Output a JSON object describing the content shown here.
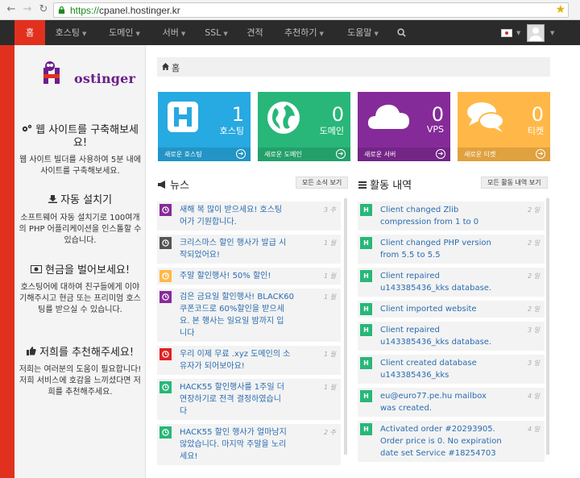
{
  "browser": {
    "url_protocol": "https://",
    "url_rest": "cpanel.hostinger.kr"
  },
  "nav": {
    "items": [
      {
        "label": "홈",
        "dropdown": false
      },
      {
        "label": "호스팅",
        "dropdown": true
      },
      {
        "label": "도메인",
        "dropdown": true
      },
      {
        "label": "서버",
        "dropdown": true
      },
      {
        "label": "SSL",
        "dropdown": true
      },
      {
        "label": "견적",
        "dropdown": false
      },
      {
        "label": "추천하기",
        "dropdown": true
      },
      {
        "label": "도움말",
        "dropdown": true
      }
    ],
    "accent": "#e2301e",
    "background": "#2b2b2b"
  },
  "sidebar": {
    "logo_text": "ostinger",
    "sections": [
      {
        "icon": "gears-icon",
        "title": "웹 사이트를 구축해보세요!",
        "text": "웹 사이트 빌더를 사용하여 5분 내에 사이트를 구축해보세요."
      },
      {
        "icon": "download-icon",
        "title": "자동 설치기",
        "text": "소프트웨어 자동 설치기로 100여개의 PHP 어플리케이션을 인스톨할 수 있습니다."
      },
      {
        "icon": "money-icon",
        "title": "현금을 벌어보세요!",
        "text": "호스팅어에 대하여 친구들에게 이야기해주시고 현금 또는 프리미엄 호스팅를 받으실 수 있습니다."
      },
      {
        "icon": "thumbs-up-icon",
        "title": "저희를 추천해주세요!",
        "text": "저희는 여러분의 도움이 필요합니다! 저희 서비스에 호감을 느끼셨다면 저희를 추천해주세요."
      }
    ]
  },
  "breadcrumb": {
    "label": "홈"
  },
  "stats": [
    {
      "count": "1",
      "label": "호스팅",
      "footer": "새로운 호스팅",
      "color": "#27a9e1",
      "icon": "hosting-h-icon"
    },
    {
      "count": "0",
      "label": "도메인",
      "footer": "새로운 도메인",
      "color": "#28b779",
      "icon": "globe-icon"
    },
    {
      "count": "0",
      "label": "VPS",
      "footer": "새로운 서버",
      "color": "#852b99",
      "icon": "cloud-icon"
    },
    {
      "count": "0",
      "label": "티켓",
      "footer": "새로운 티켓",
      "color": "#ffb848",
      "icon": "chat-icon"
    }
  ],
  "news": {
    "title": "뉴스",
    "button": "모든 소식 보기",
    "items": [
      {
        "text": [
          "새해 복 많이 받으세요! 호스팅",
          "어가 기원합니다."
        ],
        "time": "3 주",
        "color": "#852b99"
      },
      {
        "text": [
          "크리스마스 할인 행사가 발급 시",
          "작되었어요!"
        ],
        "time": "1 월",
        "color": "#555555"
      },
      {
        "text": [
          "주말 할인행사! 50% 할인!"
        ],
        "time": "1 월",
        "color": "#ffb848"
      },
      {
        "text": [
          "검은 금요일 할인행사! BLACK60",
          "쿠폰코드로 60%할인을 받으세",
          "요. 본 행사는 일요일 밤까지 입",
          "니다"
        ],
        "time": "1 월",
        "color": "#852b99"
      },
      {
        "text": [
          "우리 이제 무료 .xyz 도메인의 소",
          "유자가 되어보아요!"
        ],
        "time": "1 월",
        "color": "#e02222"
      },
      {
        "text": [
          "HACK55 할인행사를 1주일 더",
          "연장하기로 전격 결정하였습니",
          "다"
        ],
        "time": "1 월",
        "color": "#28b779"
      },
      {
        "text": [
          "HACK55 할인 행사가 얼마남지",
          "않았습니다. 마지막 주말을 노리",
          "세요!"
        ],
        "time": "2 주",
        "color": "#28b779"
      }
    ]
  },
  "activity": {
    "title": "활동 내역",
    "button": "모든 활동 내역 보기",
    "items": [
      {
        "text": [
          "Client changed Zlib",
          "compression from 1 to 0"
        ],
        "time": "2 일"
      },
      {
        "text": [
          "Client changed PHP version",
          "from 5.5 to 5.5"
        ],
        "time": "2 일"
      },
      {
        "text": [
          "Client repaired",
          "u143385436_kks database."
        ],
        "time": "2 일"
      },
      {
        "text": [
          "Client imported website"
        ],
        "time": "2 일"
      },
      {
        "text": [
          "Client repaired",
          "u143385436_kks database."
        ],
        "time": "3 일"
      },
      {
        "text": [
          "Client created database",
          "u143385436_kks"
        ],
        "time": "3 일"
      },
      {
        "text": [
          "eu@euro77.pe.hu mailbox",
          "was created."
        ],
        "time": "4 일"
      },
      {
        "text": [
          "Activated order #20293905.",
          "Order price is 0. No expiration",
          "date set Service #18254703"
        ],
        "time": "4 일"
      }
    ]
  }
}
